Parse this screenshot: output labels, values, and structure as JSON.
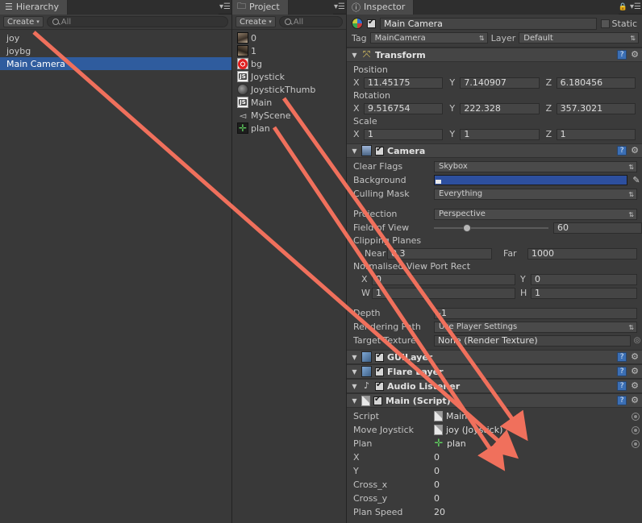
{
  "colors": {
    "accent_selection": "#2f5c9e",
    "arrow": "#f0705c",
    "camera_background": "#2d4f9e",
    "panel_bg": "#3b3b3b",
    "component_header": "#454545"
  },
  "tabs": {
    "hierarchy": "Hierarchy",
    "project": "Project",
    "inspector": "Inspector"
  },
  "hierarchy": {
    "create_label": "Create",
    "search_placeholder": "All",
    "items": [
      {
        "label": "joy",
        "selected": false
      },
      {
        "label": "joybg",
        "selected": false
      },
      {
        "label": "Main Camera",
        "selected": true
      }
    ]
  },
  "project": {
    "create_label": "Create",
    "search_placeholder": "All",
    "items": [
      {
        "label": "0",
        "icon": "image-thumbnail-icon"
      },
      {
        "label": "1",
        "icon": "image-thumbnail-icon"
      },
      {
        "label": "bg",
        "icon": "target-texture-icon"
      },
      {
        "label": "Joystick",
        "icon": "javascript-file-icon"
      },
      {
        "label": "JoystickThumb",
        "icon": "sphere-texture-icon"
      },
      {
        "label": "Main",
        "icon": "javascript-file-icon"
      },
      {
        "label": "MyScene",
        "icon": "unity-scene-icon"
      },
      {
        "label": "plan",
        "icon": "prefab-model-icon"
      }
    ]
  },
  "inspector": {
    "object_name": "Main Camera",
    "object_enabled": true,
    "static_label": "Static",
    "static_checked": false,
    "tag_label": "Tag",
    "tag_value": "MainCamera",
    "layer_label": "Layer",
    "layer_value": "Default",
    "transform": {
      "title": "Transform",
      "position_label": "Position",
      "rotation_label": "Rotation",
      "scale_label": "Scale",
      "position": {
        "x": "11.45175",
        "y": "7.140907",
        "z": "6.180456"
      },
      "rotation": {
        "x": "9.516754",
        "y": "222.328",
        "z": "357.3021"
      },
      "scale": {
        "x": "1",
        "y": "1",
        "z": "1"
      },
      "axis_x": "X",
      "axis_y": "Y",
      "axis_z": "Z"
    },
    "camera": {
      "title": "Camera",
      "enabled": true,
      "clear_flags_label": "Clear Flags",
      "clear_flags_value": "Skybox",
      "background_label": "Background",
      "background_color": "#2d4f9e",
      "culling_mask_label": "Culling Mask",
      "culling_mask_value": "Everything",
      "projection_label": "Projection",
      "projection_value": "Perspective",
      "fov_label": "Field of View",
      "fov_value": "60",
      "clipping_planes_label": "Clipping Planes",
      "near_label": "Near",
      "near_value": "0.3",
      "far_label": "Far",
      "far_value": "1000",
      "viewport_label": "Normalised View Port Rect",
      "viewport_x_label": "X",
      "viewport_x": "0",
      "viewport_y_label": "Y",
      "viewport_y": "0",
      "viewport_w_label": "W",
      "viewport_w": "1",
      "viewport_h_label": "H",
      "viewport_h": "1",
      "depth_label": "Depth",
      "depth_value": "-1",
      "rendering_path_label": "Rendering Path",
      "rendering_path_value": "Use Player Settings",
      "target_texture_label": "Target Texture",
      "target_texture_value": "None (Render Texture)"
    },
    "gui_layer": {
      "title": "GUILayer",
      "enabled": true
    },
    "flare_layer": {
      "title": "Flare Layer",
      "enabled": true
    },
    "audio_listener": {
      "title": "Audio Listener",
      "enabled": true
    },
    "main_script": {
      "title": "Main (Script)",
      "enabled": true,
      "fields": [
        {
          "label": "Script",
          "value": "Main",
          "type": "object",
          "icon": "script-file-icon"
        },
        {
          "label": "Move Joystick",
          "value": "joy (Joystick)",
          "type": "object",
          "icon": "script-file-icon"
        },
        {
          "label": "Plan",
          "value": "plan",
          "type": "object",
          "icon": "prefab-model-icon"
        },
        {
          "label": "X",
          "value": "0",
          "type": "number"
        },
        {
          "label": "Y",
          "value": "0",
          "type": "number"
        },
        {
          "label": "Cross_x",
          "value": "0",
          "type": "number"
        },
        {
          "label": "Cross_y",
          "value": "0",
          "type": "number"
        },
        {
          "label": "Plan Speed",
          "value": "20",
          "type": "number"
        }
      ]
    }
  }
}
